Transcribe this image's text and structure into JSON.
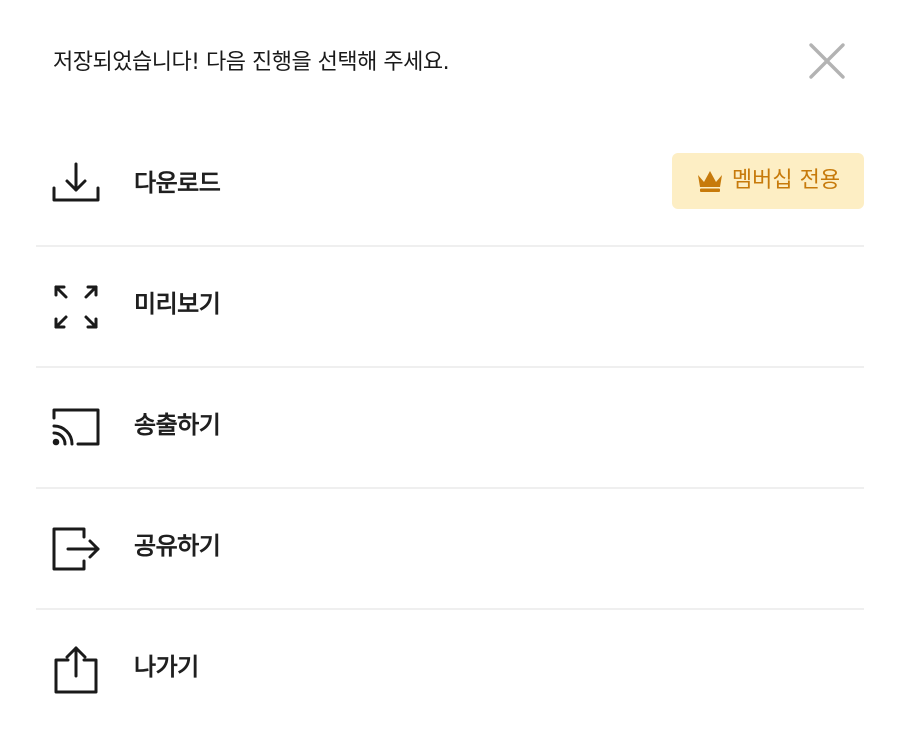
{
  "header": {
    "title": "저장되었습니다! 다음 진행을 선택해 주세요.",
    "close_icon": "close-icon"
  },
  "menu": {
    "items": [
      {
        "icon": "download-icon",
        "label": "다운로드",
        "badge": {
          "icon": "crown-icon",
          "label": "멤버십 전용"
        }
      },
      {
        "icon": "expand-icon",
        "label": "미리보기"
      },
      {
        "icon": "cast-icon",
        "label": "송출하기"
      },
      {
        "icon": "share-icon",
        "label": "공유하기"
      },
      {
        "icon": "export-icon",
        "label": "나가기"
      }
    ]
  },
  "colors": {
    "badge_bg": "#fdeec4",
    "badge_text": "#c77a0b",
    "divider": "#efefef",
    "text": "#1a1a1a",
    "close_icon": "#b3b3b3"
  }
}
